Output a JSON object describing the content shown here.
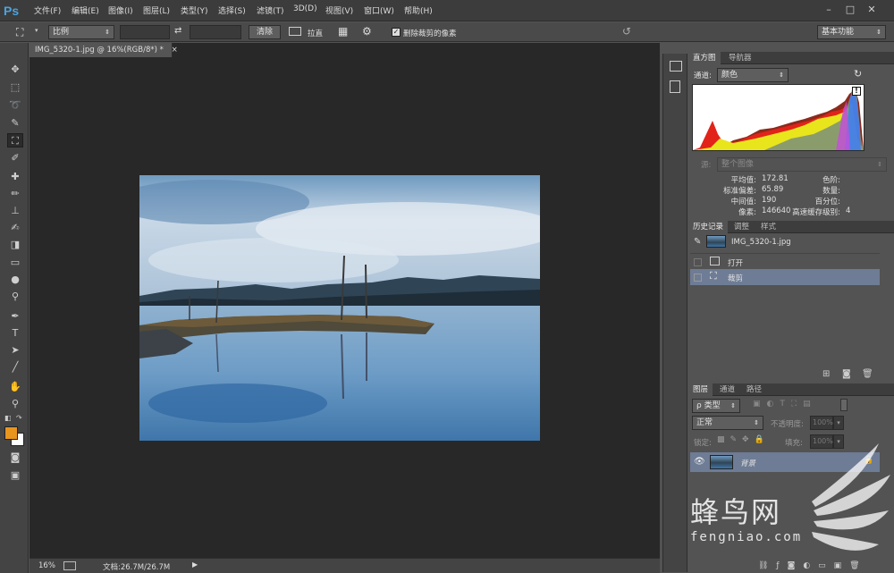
{
  "app": {
    "logo": "Ps"
  },
  "menu": [
    "文件(F)",
    "编辑(E)",
    "图像(I)",
    "图层(L)",
    "类型(Y)",
    "选择(S)",
    "滤镜(T)",
    "3D(D)",
    "视图(V)",
    "窗口(W)",
    "帮助(H)"
  ],
  "window_controls": {
    "minimize": "–",
    "restore": "□",
    "close": "✕"
  },
  "options": {
    "ratio_value": "比例",
    "clear_label": "清除",
    "straighten_label": "拉直",
    "delete_cropped_label": "删除裁剪的像素",
    "workspace": "基本功能"
  },
  "document": {
    "tab_title": "IMG_5320-1.jpg @ 16%(RGB/8*) *",
    "close": "×"
  },
  "status": {
    "zoom": "16%",
    "doc_info": "文档:26.7M/26.7M"
  },
  "histogram": {
    "tabs": [
      "直方图",
      "导航器"
    ],
    "channel_label": "通道:",
    "channel_value": "颜色",
    "source_label": "源:",
    "source_value": "整个图像",
    "stats": [
      {
        "label": "平均值:",
        "value": "172.81"
      },
      {
        "label": "标准偏差:",
        "value": "65.89"
      },
      {
        "label": "中间值:",
        "value": "190"
      },
      {
        "label": "像素:",
        "value": "146640"
      }
    ],
    "stats_right": [
      {
        "label": "色阶:",
        "value": ""
      },
      {
        "label": "数量:",
        "value": ""
      },
      {
        "label": "百分位:",
        "value": ""
      },
      {
        "label": "高速缓存级别:",
        "value": "4"
      }
    ]
  },
  "history": {
    "tabs": [
      "历史记录",
      "调整",
      "样式"
    ],
    "snapshot": "IMG_5320-1.jpg",
    "items": [
      "打开",
      "裁剪"
    ]
  },
  "layers": {
    "tabs": [
      "图层",
      "通道",
      "路径"
    ],
    "filter_label": "ρ 类型",
    "blend_mode": "正常",
    "opacity_label": "不透明度:",
    "opacity_value": "100%",
    "lock_label": "锁定:",
    "fill_label": "填充:",
    "fill_value": "100%",
    "layer_name": "背景"
  },
  "watermark": {
    "title": "蜂鸟网",
    "url": "fengniao.com"
  },
  "colors": {
    "foreground": "#e8951e",
    "background": "#ffffff",
    "accent": "#4aa3e0"
  }
}
